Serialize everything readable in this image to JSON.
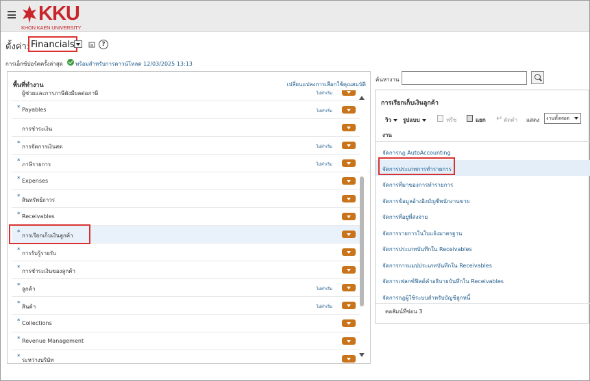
{
  "header": {
    "logo_text": "KKU",
    "logo_subtitle": "KHON KAEN UNIVERSITY",
    "brand_color": "#c8262b"
  },
  "setup": {
    "label": "ตั้งค่า:",
    "value": "Financials",
    "help_glyph": "?"
  },
  "export": {
    "label": "การเอ็กซ์ปอร์ตครั้งล่าสุด",
    "status": "พร้อมสำหรับการดาวน์โหลด 12/03/2025 13:13"
  },
  "left_panel": {
    "title": "พื้นที่ทำงาน",
    "link": "เปลี่ยนแปลงการเลือกใช้คุณสมบัติ",
    "items": [
      {
        "label": "ผู้ช่วยและการภาษีดังมีผลต่อภาษี",
        "star": false,
        "status": "ไม่ทำเริ่ม"
      },
      {
        "label": "Payables",
        "star": true,
        "status": "ไม่ทำเริ่ม"
      },
      {
        "label": "การชำระเงิน",
        "star": false,
        "status": ""
      },
      {
        "label": "การจัดการเงินสด",
        "star": true,
        "status": "ไม่ทำเริ่ม"
      },
      {
        "label": "ภาษีรายการ",
        "star": true,
        "status": "ไม่ทำเริ่ม"
      },
      {
        "label": "Expenses",
        "star": true,
        "status": ""
      },
      {
        "label": "สินทรัพย์ถาวร",
        "star": true,
        "status": ""
      },
      {
        "label": "Receivables",
        "star": true,
        "status": ""
      },
      {
        "label": "การเรียกเก็บเงินลูกค้า",
        "star": true,
        "status": ""
      },
      {
        "label": "การรับรู้รายรับ",
        "star": true,
        "status": ""
      },
      {
        "label": "การชำระเงินของลูกค้า",
        "star": true,
        "status": ""
      },
      {
        "label": "ลูกค้า",
        "star": true,
        "status": "ไม่ทำเริ่ม"
      },
      {
        "label": "สินค้า",
        "star": true,
        "status": "ไม่ทำเริ่ม"
      },
      {
        "label": "Collections",
        "star": true,
        "status": ""
      },
      {
        "label": "Revenue Management",
        "star": true,
        "status": ""
      },
      {
        "label": "ระหว่างบริษัท",
        "star": true,
        "status": ""
      }
    ],
    "star_glyph": "*"
  },
  "search": {
    "label": "ค้นหางาน",
    "value": ""
  },
  "right_panel": {
    "title": "การเรียกเก็บเงินลูกค้า",
    "toolbar": {
      "view": "วิว",
      "format": "รูปแบบ",
      "freeze": "ฟรีซ",
      "detach": "แยก",
      "wrap": "ตัดคำ",
      "show_label": "แสดง",
      "show_value": "งานทั้งหมด"
    },
    "column_header": "งาน",
    "tasks": [
      "จัดการกฎ AutoAccounting",
      "จัดการประเภทการทำรายการ",
      "จัดการที่มาของการทำรายการ",
      "จัดการข้อมูลอ้างอิงบัญชีพนักงานขาย",
      "จัดการที่อยู่ที่ส่งจ่าย",
      "จัดการรายการในใบแจ้งมาตรฐาน",
      "จัดการประเภทบันทึกใน Receivables",
      "จัดการการแมปประเภทบันทึกใน Receivables",
      "จัดการเฟลกซ์ฟิลด์คำอธิบายบันทึกใน Receivables",
      "จัดการกฎผู้ใช้ระบบสำหรับบัญชีลูกหนี้"
    ],
    "footer": "คอลัมน์ที่ซ่อน 3"
  }
}
